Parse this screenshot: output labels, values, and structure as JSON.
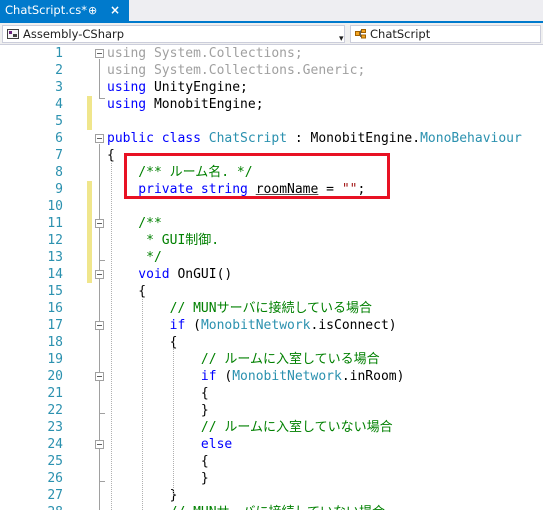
{
  "tab": {
    "title": "ChatScript.cs*",
    "pin_glyph": "⊕",
    "close_glyph": "×"
  },
  "nav": {
    "project": "Assembly-CSharp",
    "class": "ChatScript",
    "project_icon": "csharp-project-icon",
    "class_icon": "class-icon",
    "caret_glyph": "▾"
  },
  "colors": {
    "accent": "#007acc",
    "keyword": "#0000ff",
    "type": "#2b91af",
    "comment": "#008000",
    "highlight_box": "#e81123",
    "change_marker": "#f0e68c"
  },
  "editor": {
    "lines": [
      {
        "n": "1",
        "tokens": [
          {
            "t": "using System.Collections;",
            "c": "gr"
          }
        ]
      },
      {
        "n": "2",
        "tokens": [
          {
            "t": "using System.Collections.Generic;",
            "c": "gr"
          }
        ]
      },
      {
        "n": "3",
        "tokens": [
          {
            "t": "using",
            "c": "kw"
          },
          {
            "t": " UnityEngine;",
            "c": "pl"
          }
        ]
      },
      {
        "n": "4",
        "tokens": [
          {
            "t": "using",
            "c": "kw"
          },
          {
            "t": " MonobitEngine;",
            "c": "pl"
          }
        ]
      },
      {
        "n": "5",
        "tokens": []
      },
      {
        "n": "6",
        "tokens": [
          {
            "t": "public class ",
            "c": "kw"
          },
          {
            "t": "ChatScript",
            "c": "ty"
          },
          {
            "t": " : MonobitEngine.",
            "c": "pl"
          },
          {
            "t": "MonoBehaviour",
            "c": "ty"
          }
        ]
      },
      {
        "n": "7",
        "tokens": [
          {
            "t": "{",
            "c": "pl"
          }
        ]
      },
      {
        "n": "8",
        "tokens": [
          {
            "t": "    /** ルーム名. */",
            "c": "cm"
          }
        ]
      },
      {
        "n": "9",
        "tokens": [
          {
            "t": "    private string ",
            "c": "kw"
          },
          {
            "t": "roomName",
            "c": "pl"
          },
          {
            "t": " = ",
            "c": "pl"
          },
          {
            "t": "\"\"",
            "c": "st"
          },
          {
            "t": ";",
            "c": "pl"
          }
        ]
      },
      {
        "n": "10",
        "tokens": []
      },
      {
        "n": "11",
        "tokens": [
          {
            "t": "    /**",
            "c": "cm"
          }
        ]
      },
      {
        "n": "12",
        "tokens": [
          {
            "t": "     * GUI制御.",
            "c": "cm"
          }
        ]
      },
      {
        "n": "13",
        "tokens": [
          {
            "t": "     */",
            "c": "cm"
          }
        ]
      },
      {
        "n": "14",
        "tokens": [
          {
            "t": "    void ",
            "c": "kw"
          },
          {
            "t": "OnGUI()",
            "c": "pl"
          }
        ]
      },
      {
        "n": "15",
        "tokens": [
          {
            "t": "    {",
            "c": "pl"
          }
        ]
      },
      {
        "n": "16",
        "tokens": [
          {
            "t": "        // MUNサーバに接続している場合",
            "c": "cm"
          }
        ]
      },
      {
        "n": "17",
        "tokens": [
          {
            "t": "        if",
            "c": "kw"
          },
          {
            "t": " (",
            "c": "pl"
          },
          {
            "t": "MonobitNetwork",
            "c": "ty"
          },
          {
            "t": ".isConnect)",
            "c": "pl"
          }
        ]
      },
      {
        "n": "18",
        "tokens": [
          {
            "t": "        {",
            "c": "pl"
          }
        ]
      },
      {
        "n": "19",
        "tokens": [
          {
            "t": "            // ルームに入室している場合",
            "c": "cm"
          }
        ]
      },
      {
        "n": "20",
        "tokens": [
          {
            "t": "            if",
            "c": "kw"
          },
          {
            "t": " (",
            "c": "pl"
          },
          {
            "t": "MonobitNetwork",
            "c": "ty"
          },
          {
            "t": ".inRoom)",
            "c": "pl"
          }
        ]
      },
      {
        "n": "21",
        "tokens": [
          {
            "t": "            {",
            "c": "pl"
          }
        ]
      },
      {
        "n": "22",
        "tokens": [
          {
            "t": "            }",
            "c": "pl"
          }
        ]
      },
      {
        "n": "23",
        "tokens": [
          {
            "t": "            // ルームに入室していない場合",
            "c": "cm"
          }
        ]
      },
      {
        "n": "24",
        "tokens": [
          {
            "t": "            else",
            "c": "kw"
          }
        ]
      },
      {
        "n": "25",
        "tokens": [
          {
            "t": "            {",
            "c": "pl"
          }
        ]
      },
      {
        "n": "26",
        "tokens": [
          {
            "t": "            }",
            "c": "pl"
          }
        ]
      },
      {
        "n": "27",
        "tokens": [
          {
            "t": "        }",
            "c": "pl"
          }
        ]
      },
      {
        "n": "28",
        "tokens": [
          {
            "t": "        // MUNサーバに接続していない場合",
            "c": "cm"
          }
        ]
      }
    ]
  }
}
